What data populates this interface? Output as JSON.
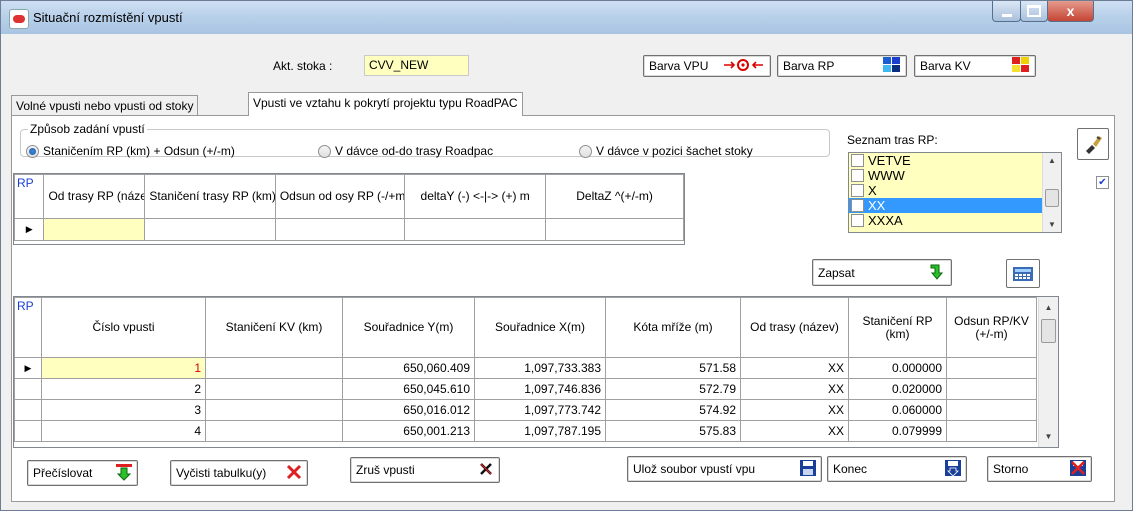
{
  "window": {
    "title": "Situační rozmístění vpustí",
    "close_glyph": "x"
  },
  "header": {
    "akt_stoka_label": "Akt. stoka :",
    "akt_stoka_value": "CVV_NEW",
    "barva_vpu": "Barva VPU",
    "barva_rp": "Barva RP",
    "barva_kv": "Barva KV"
  },
  "tabs": [
    {
      "label": "Volné vpusti nebo vpusti od stoky",
      "active": false
    },
    {
      "label": "Vpusti ve vztahu k pokrytí projektu typu RoadPAC",
      "active": true
    }
  ],
  "zpusob": {
    "title": "Způsob zadání vpustí",
    "options": [
      {
        "label": "Staničením RP (km) + Odsun (+/-m)",
        "selected": true
      },
      {
        "label": "V dávce od-do trasy Roadpac",
        "selected": false
      },
      {
        "label": "V dávce v pozici  šachet stoky",
        "selected": false
      }
    ]
  },
  "upper_grid": {
    "corner": "RP",
    "columns": [
      "Od trasy RP (název)",
      "Staničení trasy RP (km)",
      "Odsun od osy RP (-/+m)",
      "deltaY (-) <-|-> (+) m",
      "DeltaZ ^(+/-m)"
    ]
  },
  "seznam": {
    "label": "Seznam tras RP:",
    "items": [
      {
        "label": "VETVE",
        "selected": false
      },
      {
        "label": "WWW",
        "selected": false
      },
      {
        "label": "X",
        "selected": false
      },
      {
        "label": "XX",
        "selected": true
      },
      {
        "label": "XXXA",
        "selected": false
      }
    ]
  },
  "zapsat_label": "Zapsat",
  "lower_grid": {
    "corner": "RP",
    "columns": [
      "Číslo vpusti",
      "Staničení KV (km)",
      "Souřadnice Y(m)",
      "Souřadnice X(m)",
      "Kóta mříže (m)",
      "Od trasy (název)",
      "Staničení RP (km)",
      "Odsun RP/KV (+/-m)"
    ],
    "rows": [
      [
        "1",
        "",
        "650,060.409",
        "1,097,733.383",
        "571.58",
        "XX",
        "0.000000",
        ""
      ],
      [
        "2",
        "",
        "650,045.610",
        "1,097,746.836",
        "572.79",
        "XX",
        "0.020000",
        ""
      ],
      [
        "3",
        "",
        "650,016.012",
        "1,097,773.742",
        "574.92",
        "XX",
        "0.060000",
        ""
      ],
      [
        "4",
        "",
        "650,001.213",
        "1,097,787.195",
        "575.83",
        "XX",
        "0.079999",
        ""
      ]
    ]
  },
  "buttons": {
    "precislovat": "Přečíslovat",
    "vycisti": "Vyčisti tabulku(y)",
    "zrus": "Zruš vpusti",
    "uloz": "Ulož soubor vpustí vpu",
    "konec": "Konec",
    "storno": "Storno"
  }
}
